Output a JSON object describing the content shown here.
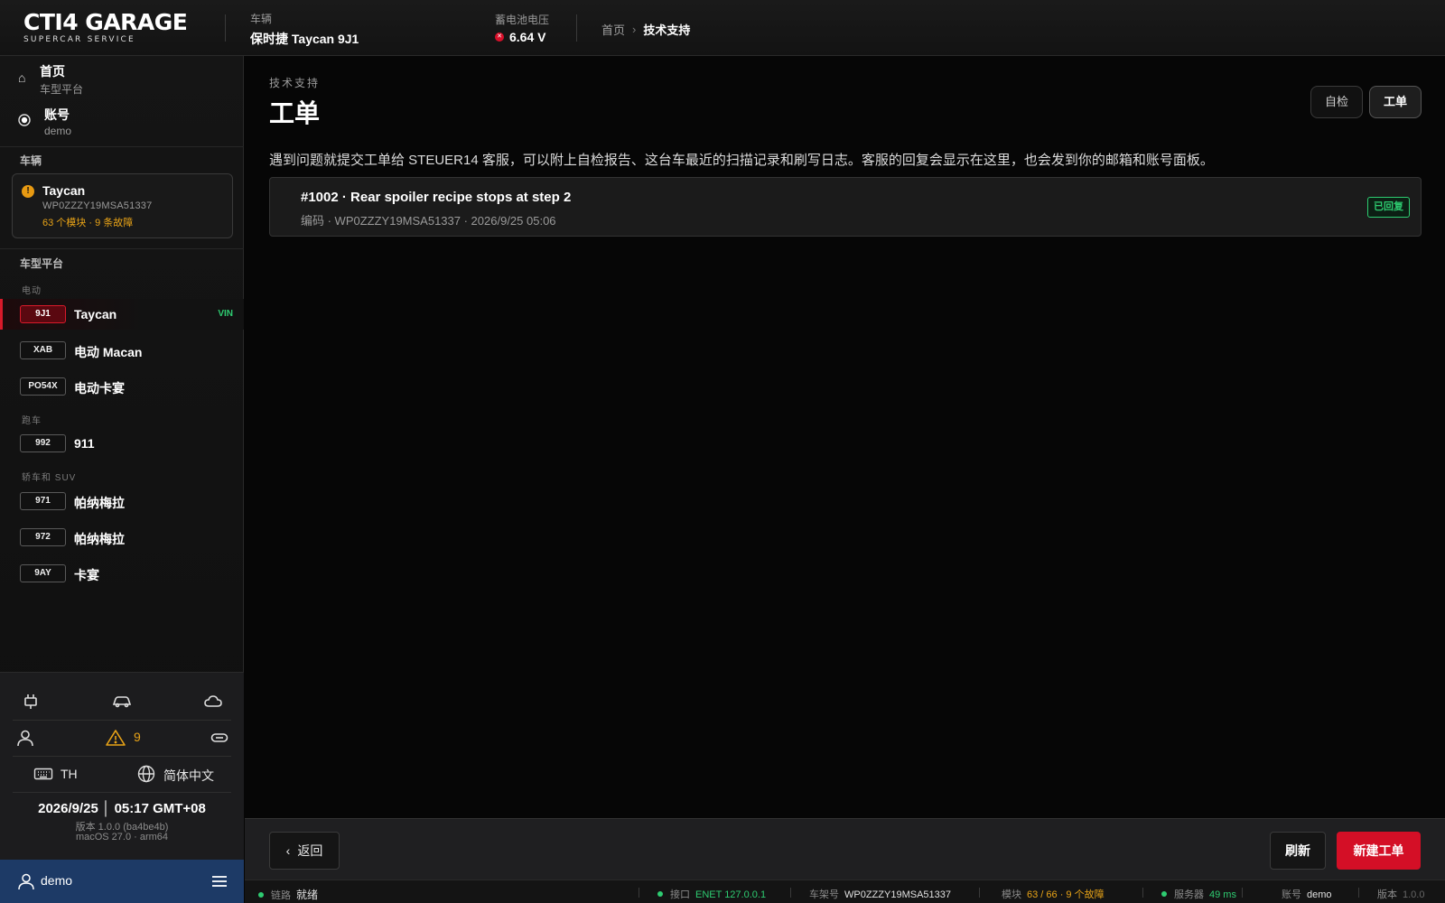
{
  "app": {
    "logo_main": "CTI4 GARAGE",
    "logo_sub": "SUPERCAR SERVICE"
  },
  "header": {
    "vehicle_label": "车辆",
    "vehicle_value": "保时捷 Taycan 9J1",
    "voltage_label": "蓄电池电压",
    "voltage_value": "6.64 V",
    "voltage_status_icon": "error-icon",
    "breadcrumb": [
      "首页",
      "技术支持"
    ]
  },
  "sidebar": {
    "nav": [
      {
        "title": "首页",
        "sub": "车型平台",
        "icon": "home-icon"
      },
      {
        "title": "账号",
        "sub": "demo",
        "icon": "radio-icon"
      }
    ],
    "vehicle_section": "车辆",
    "vehicle_card": {
      "name": "Taycan",
      "vin": "WP0ZZZY19MSA51337",
      "status": "63 个模块 · 9 条故障"
    },
    "platform_section": "车型平台",
    "groups": [
      {
        "label": "电动",
        "items": [
          {
            "code": "9J1",
            "name": "Taycan",
            "tag": "VIN",
            "active": true
          },
          {
            "code": "XAB",
            "name": "电动 Macan",
            "tag": ""
          },
          {
            "code": "PO54X",
            "name": "电动卡宴",
            "tag": ""
          }
        ]
      },
      {
        "label": "跑车",
        "items": [
          {
            "code": "992",
            "name": "911",
            "tag": ""
          }
        ]
      },
      {
        "label": "轿车和 SUV",
        "items": [
          {
            "code": "971",
            "name": "帕纳梅拉",
            "tag": ""
          },
          {
            "code": "972",
            "name": "帕纳梅拉",
            "tag": ""
          },
          {
            "code": "9AY",
            "name": "卡宴",
            "tag": ""
          }
        ]
      }
    ],
    "tools": {
      "row1": [
        "plug-icon",
        "car-icon",
        "cloud-icon"
      ],
      "row2": [
        "user-icon",
        "warning-icon",
        "link-icon"
      ],
      "warning_count": "9",
      "keyboard_layout": "TH",
      "language": "简体中文",
      "datetime": "2026/9/25 │ 05:17 GMT+08",
      "version": "版本 1.0.0 (ba4be4b)",
      "os": "macOS 27.0 · arm64"
    },
    "user": {
      "name": "demo"
    }
  },
  "main": {
    "eyebrow": "技术支持",
    "title": "工单",
    "tabs": [
      {
        "label": "自检",
        "active": false
      },
      {
        "label": "工单",
        "active": true
      }
    ],
    "intro": "遇到问题就提交工单给 STEUER14 客服，可以附上自检报告、这台车最近的扫描记录和刷写日志。客服的回复会显示在这里，也会发到你的邮箱和账号面板。",
    "tickets": [
      {
        "title": "#1002 · Rear spoiler recipe stops at step 2",
        "meta": "编码 · WP0ZZZY19MSA51337 · 2026/9/25 05:06",
        "status": "已回复"
      }
    ]
  },
  "actions": {
    "back": "返回",
    "refresh": "刷新",
    "new_ticket": "新建工单"
  },
  "statusbar": {
    "link_label": "链路",
    "link_value": "就绪",
    "port_label": "接口",
    "port_value": "ENET 127.0.0.1",
    "vin_label": "车架号",
    "vin_value": "WP0ZZZY19MSA51337",
    "module_label": "模块",
    "module_value": "63 / 66 · 9 个故障",
    "server_label": "服务器",
    "server_value": "49 ms",
    "account_label": "账号",
    "account_value": "demo",
    "version_label": "版本",
    "version_value": "1.0.0"
  },
  "colors": {
    "accent_red": "#d40f26",
    "success_green": "#2ecc71",
    "warning_amber": "#e8a317",
    "user_bar_blue": "#1d3a66"
  }
}
